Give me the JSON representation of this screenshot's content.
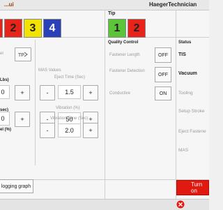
{
  "window": {
    "title": "...ui",
    "user": "HaegerTechnician"
  },
  "presets": {
    "items": [
      {
        "label": "2",
        "color": "#e8231a",
        "text_color": "#222222"
      },
      {
        "label": "3",
        "color": "#f2e400",
        "text_color": "#222222"
      },
      {
        "label": "4",
        "color": "#2a3fb8",
        "text_color": "#ffffff"
      }
    ],
    "partial_color": "#e8231a"
  },
  "tip": {
    "label": "Tip",
    "items": [
      {
        "label": "1",
        "color": "#5cc43a",
        "text_color": "#222222"
      },
      {
        "label": "2",
        "color": "#e8231a",
        "text_color": "#222222"
      }
    ]
  },
  "left_column": {
    "partial_label_1": "er",
    "partial_label_2": "Lbs)",
    "partial_label_3": "sec)",
    "partial_label_4": "el (%)",
    "value_1": "0",
    "value_2": "0",
    "plus_label": "+"
  },
  "mas": {
    "title": "MAS Values",
    "eject_time_label": "Eject Time (Sec)",
    "eject_time_value": "1.5",
    "vibration_label": "Vibration (%)",
    "vibration_value": "50",
    "vibration_time_label": "Vibration Time (Sec)",
    "vibration_time_value": "2.0",
    "minus_label": "-",
    "plus_label": "+"
  },
  "quality_control": {
    "title": "Quality Control",
    "rows": [
      {
        "label": "Fastener Length",
        "state": "OFF"
      },
      {
        "label": "Fastener Detection",
        "state": "OFF"
      },
      {
        "label": "Conductive",
        "state": "ON"
      }
    ]
  },
  "status": {
    "title": "Status",
    "items": [
      {
        "label": "TIS",
        "active": true
      },
      {
        "label": "Vacuum",
        "active": true
      },
      {
        "label": "Tooling",
        "active": false
      },
      {
        "label": "Setup Stroke",
        "active": false
      },
      {
        "label": "Eject Fastene",
        "active": false
      },
      {
        "label": "MAS",
        "active": false
      }
    ],
    "turn_on_label": "Turn on"
  },
  "footer": {
    "logging_label": "logging graph"
  },
  "colors": {
    "turn_on_bg": "#e01a10",
    "close_icon": "#e01a10"
  }
}
